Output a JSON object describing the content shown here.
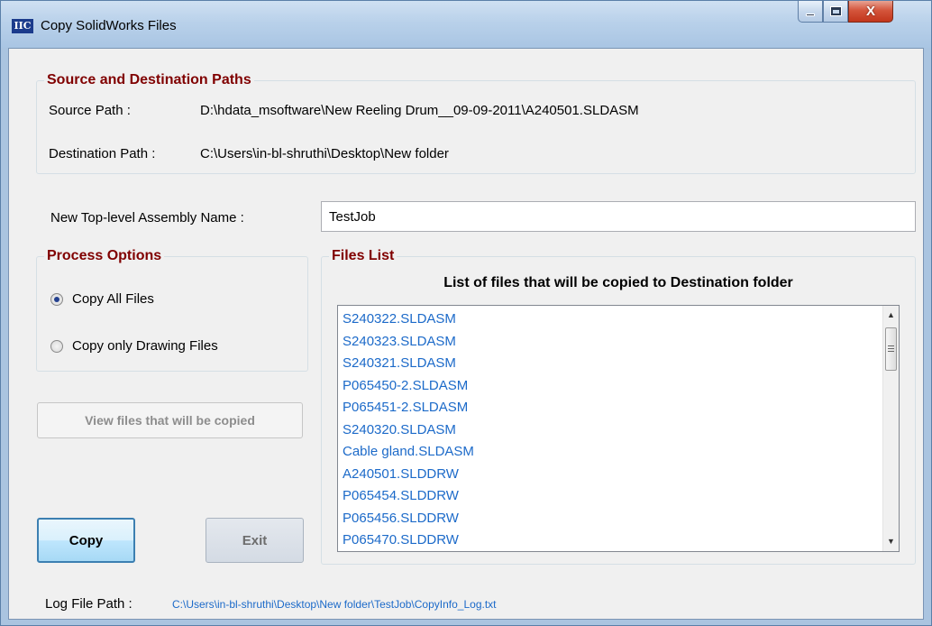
{
  "window": {
    "title": "Copy SolidWorks Files",
    "icon_text": "IIC",
    "controls": {
      "minimize": "minimize-icon",
      "maximize": "maximize-icon",
      "close": "X"
    }
  },
  "paths": {
    "group_title": "Source and Destination Paths",
    "source_label": "Source Path :",
    "source_value": "D:\\hdata_msoftware\\New Reeling Drum__09-09-2011\\A240501.SLDASM",
    "dest_label": "Destination Path :",
    "dest_value": "C:\\Users\\in-bl-shruthi\\Desktop\\New folder"
  },
  "assembly": {
    "label": "New Top-level Assembly Name :",
    "value": "TestJob"
  },
  "process": {
    "group_title": "Process Options",
    "options": [
      {
        "label": "Copy All Files",
        "checked": true
      },
      {
        "label": "Copy only Drawing Files",
        "checked": false
      }
    ]
  },
  "files": {
    "group_title": "Files List",
    "heading": "List of files that will be copied to Destination folder",
    "items": [
      "S240322.SLDASM",
      "S240323.SLDASM",
      "S240321.SLDASM",
      "P065450-2.SLDASM",
      "P065451-2.SLDASM",
      "S240320.SLDASM",
      "Cable gland.SLDASM",
      "A240501.SLDDRW",
      "P065454.SLDDRW",
      "P065456.SLDDRW",
      "P065470.SLDDRW"
    ]
  },
  "buttons": {
    "view": "View files that will be copied",
    "copy": "Copy",
    "exit": "Exit"
  },
  "log": {
    "label": "Log File Path :",
    "value": "C:\\Users\\in-bl-shruthi\\Desktop\\New folder\\TestJob\\CopyInfo_Log.txt"
  },
  "colors": {
    "group_title": "#800000",
    "list_text": "#1c6ac9",
    "radio_dot": "#23408e"
  }
}
